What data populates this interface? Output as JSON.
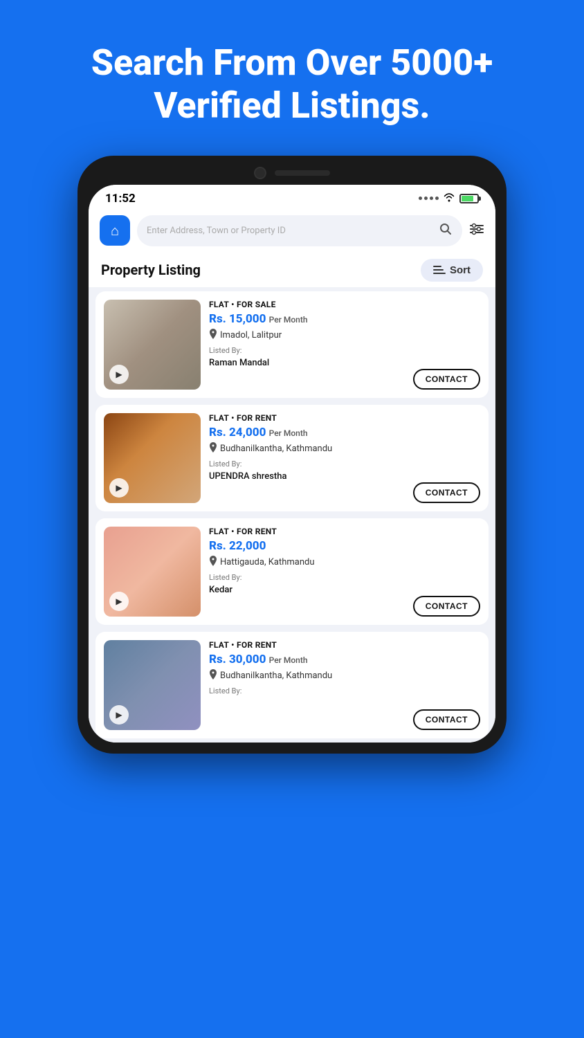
{
  "hero": {
    "title": "Search From Over 5000+ Verified Listings."
  },
  "status_bar": {
    "time": "11:52",
    "dots": "···",
    "wifi": "wifi",
    "battery": "battery"
  },
  "search": {
    "placeholder": "Enter Address, Town or Property ID"
  },
  "listing_section": {
    "title": "Property Listing",
    "sort_label": "Sort"
  },
  "listings": [
    {
      "type": "FLAT • FOR SALE",
      "price": "Rs. 15,000",
      "price_period": "Per Month",
      "location": "Imadol, Lalitpur",
      "listed_by_label": "Listed By:",
      "listed_by_name": "Raman Mandal",
      "contact_label": "CONTACT",
      "img_class": "img-flat1"
    },
    {
      "type": "FLAT • FOR RENT",
      "price": "Rs. 24,000",
      "price_period": "Per Month",
      "location": "Budhanilkantha, Kathmandu",
      "listed_by_label": "Listed By:",
      "listed_by_name": "UPENDRA shrestha",
      "contact_label": "CONTACT",
      "img_class": "img-flat2"
    },
    {
      "type": "FLAT • FOR RENT",
      "price": "Rs. 22,000",
      "price_period": "",
      "location": "Hattigauda, Kathmandu",
      "listed_by_label": "Listed By:",
      "listed_by_name": "Kedar",
      "contact_label": "CONTACT",
      "img_class": "img-flat3"
    },
    {
      "type": "FLAT • FOR RENT",
      "price": "Rs. 30,000",
      "price_period": "Per Month",
      "location": "Budhanilkantha, Kathmandu",
      "listed_by_label": "Listed By:",
      "listed_by_name": "",
      "contact_label": "CONTACT",
      "img_class": "img-flat4"
    }
  ]
}
